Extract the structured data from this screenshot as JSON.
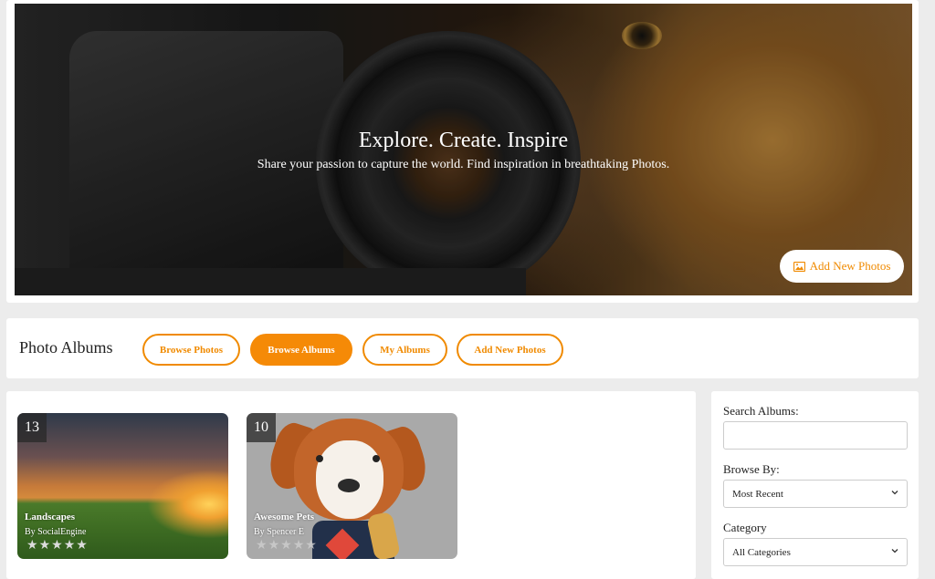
{
  "hero": {
    "title": "Explore. Create. Inspire",
    "subtitle": "Share your passion to capture the world. Find inspiration in breathtaking Photos.",
    "add_button": "Add New Photos"
  },
  "nav": {
    "title": "Photo Albums",
    "tabs": [
      {
        "label": "Browse Photos",
        "active": false
      },
      {
        "label": "Browse Albums",
        "active": true
      },
      {
        "label": "My Albums",
        "active": false
      },
      {
        "label": "Add New Photos",
        "active": false
      }
    ]
  },
  "albums": [
    {
      "count": "13",
      "name": "Landscapes",
      "by": "By SocialEngine",
      "rating": 5,
      "max_rating": 5
    },
    {
      "count": "10",
      "name": "Awesome Pets",
      "by": "By Spencer E",
      "rating": 0,
      "max_rating": 5
    }
  ],
  "sidebar": {
    "search_label": "Search Albums:",
    "search_value": "",
    "browse_label": "Browse By:",
    "browse_value": "Most Recent",
    "category_label": "Category",
    "category_value": "All Categories"
  },
  "colors": {
    "accent": "#f58a07",
    "background": "#ececec"
  }
}
